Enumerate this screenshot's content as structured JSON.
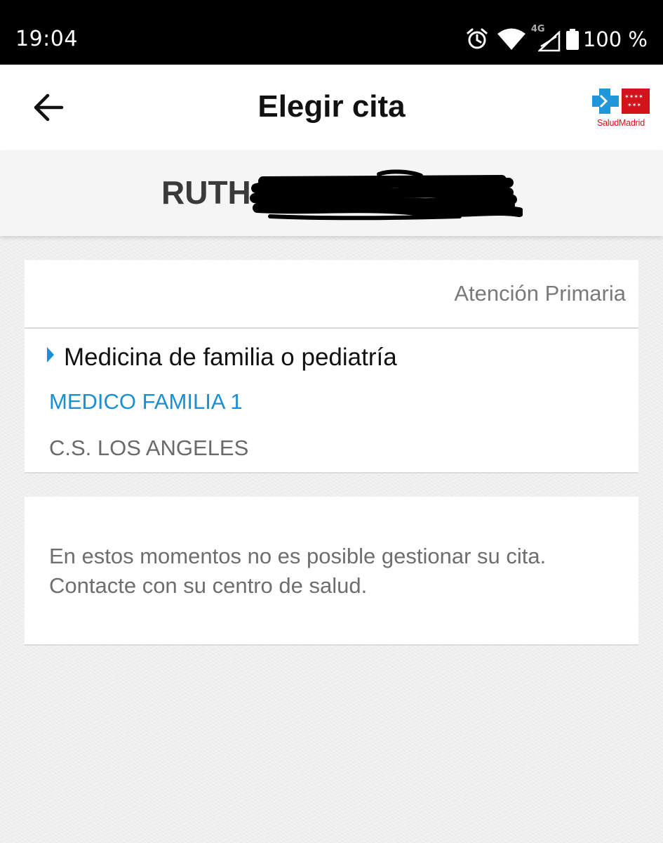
{
  "status_bar": {
    "time": "19:04",
    "network": "4G",
    "battery": "100 %",
    "icons": [
      "alarm-icon",
      "wifi-icon",
      "cell-signal-icon",
      "battery-icon"
    ]
  },
  "app_bar": {
    "title": "Elegir cita",
    "back_icon": "arrow-back-icon",
    "logo_text": "SaludMadrid"
  },
  "patient": {
    "name": "RUTH"
  },
  "appointment_card": {
    "header": "Atención Primaria",
    "service": "Medicina de familia o pediatría",
    "doctor": "MEDICO FAMILIA 1",
    "center": "C.S. LOS ANGELES"
  },
  "message_card": {
    "message": "En estos momentos no es posible gestionar su cita.\nContacte con su centro de salud."
  },
  "colors": {
    "accent": "#1a8fd1",
    "logo_red": "#d4121b",
    "logo_blue": "#2196d8",
    "background": "#efefef"
  }
}
